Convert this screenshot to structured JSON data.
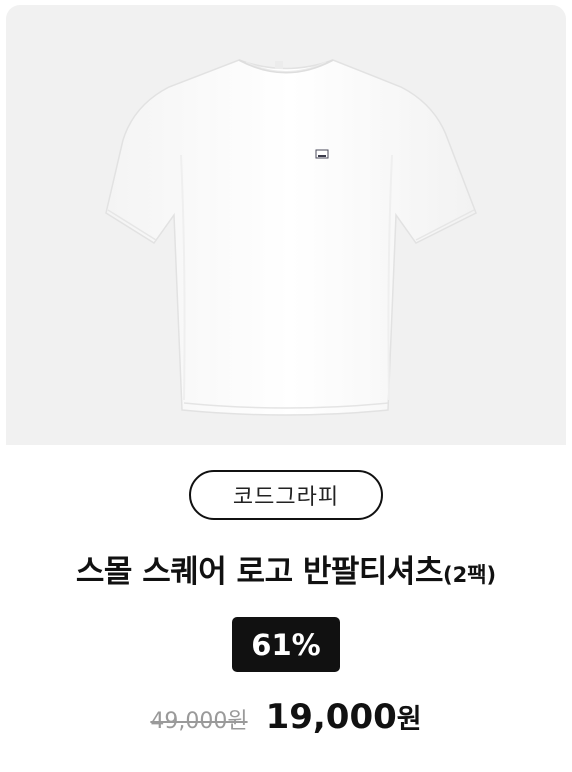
{
  "product": {
    "image_icon": "tshirt-photo",
    "brand": "코드그라피",
    "title_main": "스몰 스퀘어 로고 반팔티셔츠",
    "title_sub": "(2팩)",
    "discount": "61%",
    "original_price": "49,000원",
    "sale_price_number": "19,000",
    "sale_price_unit": "원"
  },
  "colors": {
    "image_background": "#f1f1f1",
    "discount_badge": "#111111",
    "strikethrough_price": "#9a9a9a"
  }
}
